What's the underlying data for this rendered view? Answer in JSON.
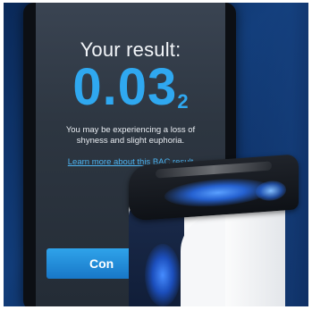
{
  "screen": {
    "title": "Your result:",
    "value_main": "0.03",
    "value_sub": "2",
    "message": "You may be experiencing a loss of shyness and slight euphoria.",
    "link": "Learn more about this BAC result",
    "button_label": "Con"
  },
  "colors": {
    "background": "#123d7a",
    "accent": "#2fa8f0",
    "button": "#1f8ad8",
    "led": "#3f7fff"
  }
}
